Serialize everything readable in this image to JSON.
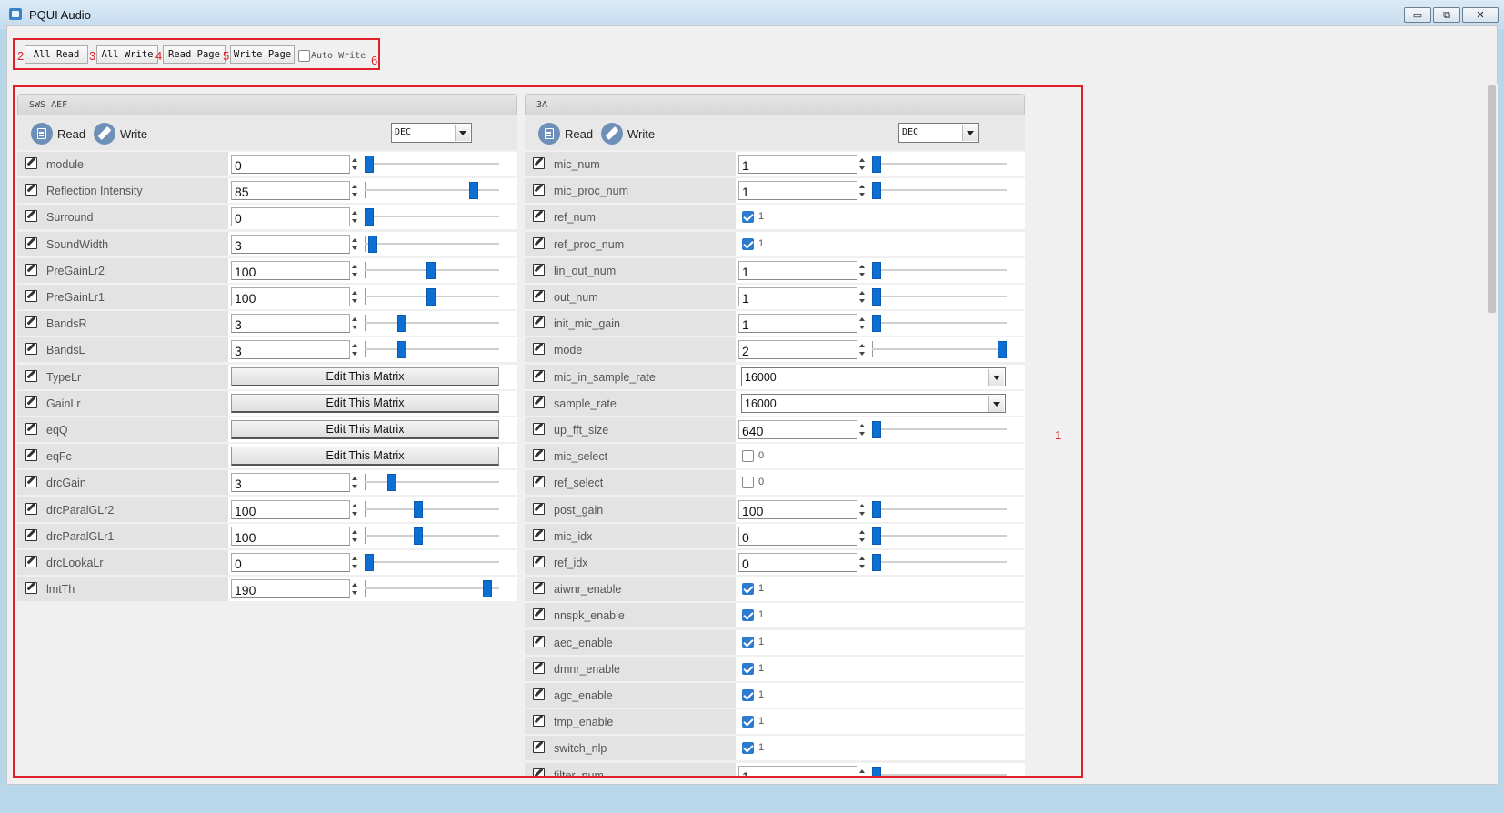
{
  "window": {
    "title": "PQUI Audio",
    "controls": {
      "minimize": "▭",
      "restore": "⧉",
      "close": "✕"
    }
  },
  "toolbar": {
    "buttons": [
      {
        "label": "All Read",
        "annotation": "2"
      },
      {
        "label": "All Write",
        "annotation": "3"
      },
      {
        "label": "Read Page",
        "annotation": "4"
      },
      {
        "label": "Write Page",
        "annotation": "5"
      }
    ],
    "auto_write_label": "Auto Write",
    "auto_write_checked": false,
    "auto_write_annotation": "6"
  },
  "main_annotation": "1",
  "colors": {
    "annotation": "#e0202a",
    "slider_handle": "#0d6fd1",
    "checkbox_checked": "#2b7bd0"
  },
  "panels": [
    {
      "title": "SWS AEF",
      "read_label": "Read",
      "write_label": "Write",
      "format": "DEC",
      "rows": [
        {
          "label": "module",
          "type": "number",
          "value": "0",
          "slider_percent": 0
        },
        {
          "label": "Reflection Intensity",
          "type": "number",
          "value": "85",
          "slider_percent": 83
        },
        {
          "label": "Surround",
          "type": "number",
          "value": "0",
          "slider_percent": 0
        },
        {
          "label": "SoundWidth",
          "type": "number",
          "value": "3",
          "slider_percent": 3
        },
        {
          "label": "PreGainLr2",
          "type": "number",
          "value": "100",
          "slider_percent": 49
        },
        {
          "label": "PreGainLr1",
          "type": "number",
          "value": "100",
          "slider_percent": 49
        },
        {
          "label": "BandsR",
          "type": "number",
          "value": "3",
          "slider_percent": 26
        },
        {
          "label": "BandsL",
          "type": "number",
          "value": "3",
          "slider_percent": 26
        },
        {
          "label": "TypeLr",
          "type": "matrix",
          "value": "Edit This Matrix"
        },
        {
          "label": "GainLr",
          "type": "matrix",
          "value": "Edit This Matrix"
        },
        {
          "label": "eqQ",
          "type": "matrix",
          "value": "Edit This Matrix"
        },
        {
          "label": "eqFc",
          "type": "matrix",
          "value": "Edit This Matrix"
        },
        {
          "label": "drcGain",
          "type": "number",
          "value": "3",
          "slider_percent": 18
        },
        {
          "label": "drcParalGLr2",
          "type": "number",
          "value": "100",
          "slider_percent": 39
        },
        {
          "label": "drcParalGLr1",
          "type": "number",
          "value": "100",
          "slider_percent": 39
        },
        {
          "label": "drcLookaLr",
          "type": "number",
          "value": "0",
          "slider_percent": 0
        },
        {
          "label": "lmtTh",
          "type": "number",
          "value": "190",
          "slider_percent": 94
        }
      ]
    },
    {
      "title": "3A",
      "read_label": "Read",
      "write_label": "Write",
      "format": "DEC",
      "rows": [
        {
          "label": "mic_num",
          "type": "number",
          "value": "1",
          "slider_percent": 0
        },
        {
          "label": "mic_proc_num",
          "type": "number",
          "value": "1",
          "slider_percent": 0
        },
        {
          "label": "ref_num",
          "type": "check",
          "value": "1",
          "checked": true
        },
        {
          "label": "ref_proc_num",
          "type": "check",
          "value": "1",
          "checked": true
        },
        {
          "label": "lin_out_num",
          "type": "number",
          "value": "1",
          "slider_percent": 0
        },
        {
          "label": "out_num",
          "type": "number",
          "value": "1",
          "slider_percent": 0
        },
        {
          "label": "init_mic_gain",
          "type": "number",
          "value": "1",
          "slider_percent": 0
        },
        {
          "label": "mode",
          "type": "number",
          "value": "2",
          "slider_percent": 100
        },
        {
          "label": "mic_in_sample_rate",
          "type": "select",
          "value": "16000"
        },
        {
          "label": "sample_rate",
          "type": "select",
          "value": "16000"
        },
        {
          "label": "up_fft_size",
          "type": "number",
          "value": "640",
          "slider_percent": 0
        },
        {
          "label": "mic_select",
          "type": "check",
          "value": "0",
          "checked": false
        },
        {
          "label": "ref_select",
          "type": "check",
          "value": "0",
          "checked": false
        },
        {
          "label": "post_gain",
          "type": "number",
          "value": "100",
          "slider_percent": 0
        },
        {
          "label": "mic_idx",
          "type": "number",
          "value": "0",
          "slider_percent": 0
        },
        {
          "label": "ref_idx",
          "type": "number",
          "value": "0",
          "slider_percent": 0
        },
        {
          "label": "aiwnr_enable",
          "type": "check",
          "value": "1",
          "checked": true
        },
        {
          "label": "nnspk_enable",
          "type": "check",
          "value": "1",
          "checked": true
        },
        {
          "label": "aec_enable",
          "type": "check",
          "value": "1",
          "checked": true
        },
        {
          "label": "dmnr_enable",
          "type": "check",
          "value": "1",
          "checked": true
        },
        {
          "label": "agc_enable",
          "type": "check",
          "value": "1",
          "checked": true
        },
        {
          "label": "fmp_enable",
          "type": "check",
          "value": "1",
          "checked": true
        },
        {
          "label": "switch_nlp",
          "type": "check",
          "value": "1",
          "checked": true
        },
        {
          "label": "filter_num",
          "type": "number",
          "value": "1",
          "slider_percent": 0
        }
      ]
    }
  ]
}
